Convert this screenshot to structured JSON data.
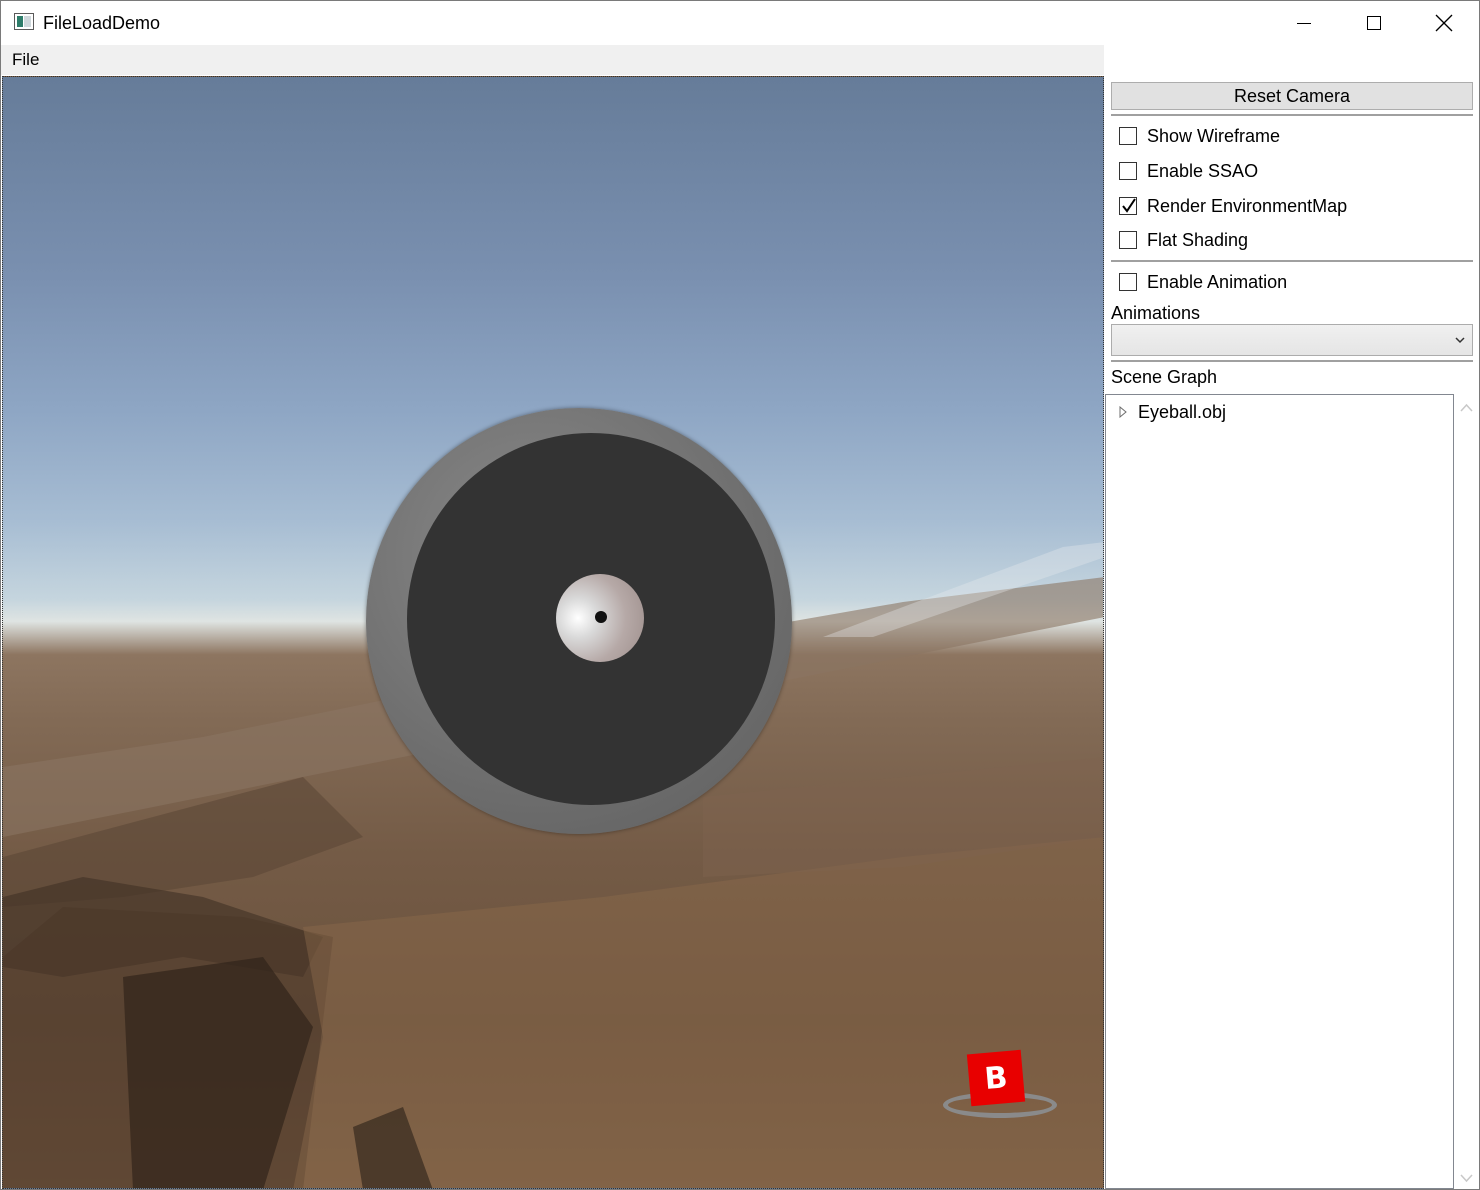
{
  "window": {
    "title": "FileLoadDemo"
  },
  "menu": {
    "file": "File"
  },
  "panel": {
    "reset_camera": "Reset Camera",
    "checks": [
      {
        "label": "Show Wireframe",
        "checked": false
      },
      {
        "label": "Enable SSAO",
        "checked": false
      },
      {
        "label": "Render EnvironmentMap",
        "checked": true
      },
      {
        "label": "Flat Shading",
        "checked": false
      }
    ],
    "enable_animation": {
      "label": "Enable Animation",
      "checked": false
    },
    "animations_label": "Animations",
    "animations_selected": "",
    "scene_graph_label": "Scene Graph",
    "scene_graph_items": [
      "Eyeball.obj"
    ]
  },
  "viewport": {
    "nav_cube_letter": "B"
  },
  "colors": {
    "accent_red": "#e80000",
    "iris": "#333333"
  }
}
